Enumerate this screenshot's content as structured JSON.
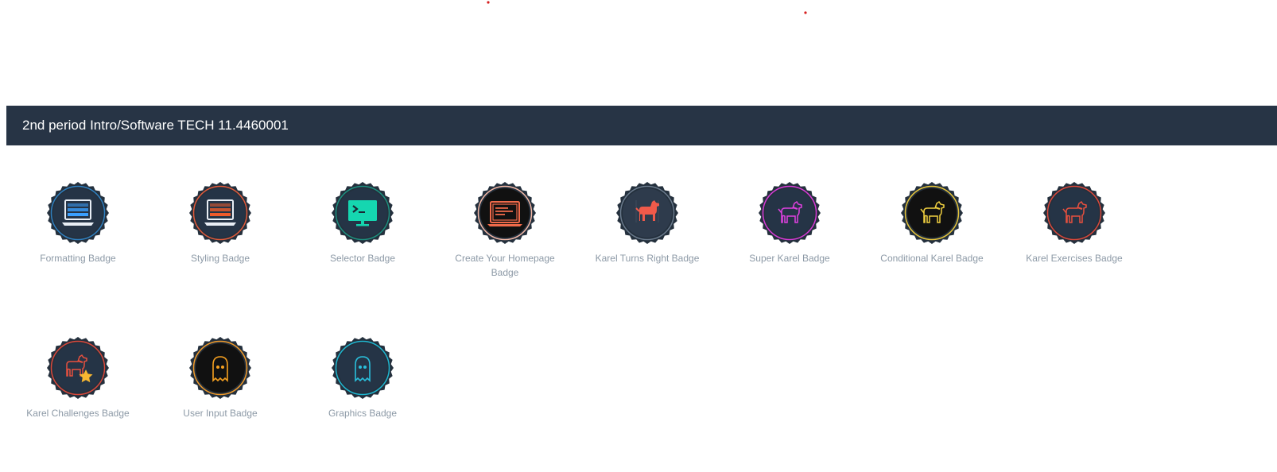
{
  "section": {
    "title": "2nd period Intro/Software TECH 11.4460001"
  },
  "badges": [
    {
      "label": "Formatting Badge",
      "icon": "monitor-bars-icon",
      "ring": "#2f7fbf",
      "inner": "#253446",
      "accent": "#3aa0ff"
    },
    {
      "label": "Styling Badge",
      "icon": "monitor-bars-icon",
      "ring": "#e05a3a",
      "inner": "#253446",
      "accent": "#ef5b2b"
    },
    {
      "label": "Selector Badge",
      "icon": "terminal-monitor-icon",
      "ring": "#1d8f7f",
      "inner": "#253446",
      "accent": "#15d6b0"
    },
    {
      "label": "Create Your Homepage Badge",
      "icon": "browser-window-icon",
      "ring": "#f2b8a6",
      "inner": "#111111",
      "accent": "#f06a4a"
    },
    {
      "label": "Karel Turns Right Badge",
      "icon": "dog-icon",
      "ring": "#6a7a8c",
      "inner": "#2e3b4c",
      "accent": "#f05a4a"
    },
    {
      "label": "Super Karel Badge",
      "icon": "dog-outline-icon",
      "ring": "#d63ad6",
      "inner": "#253446",
      "accent": "#e040e0"
    },
    {
      "label": "Conditional Karel Badge",
      "icon": "dog-outline-icon",
      "ring": "#e6c43a",
      "inner": "#111111",
      "accent": "#f0d040"
    },
    {
      "label": "Karel Exercises Badge",
      "icon": "dog-outline-icon",
      "ring": "#d9483b",
      "inner": "#253446",
      "accent": "#e8503e"
    },
    {
      "label": "Karel Challenges Badge",
      "icon": "dog-star-icon",
      "ring": "#d9483b",
      "inner": "#253446",
      "accent": "#e8503e"
    },
    {
      "label": "User Input Badge",
      "icon": "ghost-icon",
      "ring": "#f09a2a",
      "inner": "#111111",
      "accent": "#f5a020"
    },
    {
      "label": "Graphics Badge",
      "icon": "ghost-icon",
      "ring": "#1fb6d0",
      "inner": "#253446",
      "accent": "#2ac0dc"
    }
  ]
}
